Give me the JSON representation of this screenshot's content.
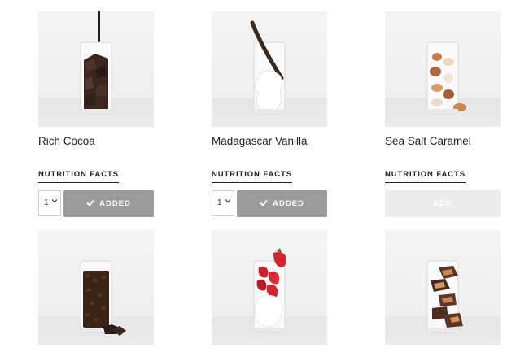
{
  "products": [
    {
      "name": "Rich Cocoa",
      "nutrition_label": "NUTRITION FACTS",
      "quantity": "1",
      "button_label": "ADDED",
      "state": "added"
    },
    {
      "name": "Madagascar Vanilla",
      "nutrition_label": "NUTRITION FACTS",
      "quantity": "1",
      "button_label": "ADDED",
      "state": "added"
    },
    {
      "name": "Sea Salt Caramel",
      "nutrition_label": "NUTRITION FACTS",
      "button_label": "ADD",
      "state": "add"
    },
    {
      "image": "coffee-beans-glass"
    },
    {
      "image": "strawberry-cream-glass"
    },
    {
      "image": "peanut-butter-cups-glass"
    }
  ],
  "icons": {
    "check": "check-icon",
    "dropdown": "chevron-down-icon"
  },
  "colors": {
    "added_button": "#9b9b9b",
    "add_button_disabled": "#ececec",
    "text": "#1d1d1d"
  }
}
